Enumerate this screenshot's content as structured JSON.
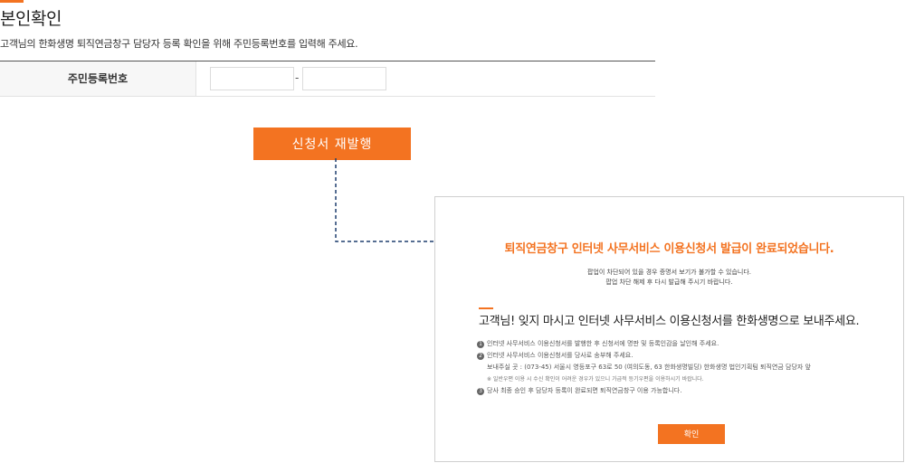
{
  "page": {
    "title": "본인확인",
    "description": "고객님의 한화생명 퇴직연금창구 담당자 등록 확인을 위해 주민등록번호를 입력해 주세요."
  },
  "form": {
    "rrn_label": "주민등록번호",
    "rrn_first_value": "",
    "rrn_second_value": "",
    "separator": "-"
  },
  "actions": {
    "reissue_label": "신청서 재발행"
  },
  "popup": {
    "title": "퇴직연금창구 인터넷 사무서비스 이용신청서 발급이 완료되었습니다.",
    "note_line1": "팝업이 차단되어 있을 경우 증명서 보기가 불가할 수 있습니다.",
    "note_line2": "팝업 차단 해제 후 다시 발급해 주시기 바랍니다.",
    "heading": "고객님! 잊지 마시고 인터넷 사무서비스 이용신청서를 한화생명으로 보내주세요.",
    "steps": [
      {
        "num": "1",
        "text": "인터넷 사무서비스 이용신청서를 발행한 후 신청서에 명판 및 등록인감을 날인해 주세요."
      },
      {
        "num": "2",
        "text": "인터넷 사무서비스 이용신청서를 당사로 송부해 주세요."
      },
      {
        "num": "3",
        "text": "당사 최종 승인 후 담당자 등록이 완료되면 퇴직연금창구 이용 가능합니다."
      }
    ],
    "address": "보내주실 곳 : (073-45) 서울시 영등포구 63로 50 (여의도동, 63 한화생명빌딩) 한화생명 법인기획팀 퇴직연금 담당자 앞",
    "caution": "※ 일반우편 이용 시 수신 확인이 어려운 경우가 있으니 가급적 등기우편을 이용하시기 바랍니다.",
    "confirm_label": "확인"
  },
  "colors": {
    "accent": "#f37321",
    "connector": "#1f3f6e"
  }
}
